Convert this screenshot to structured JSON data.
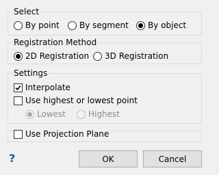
{
  "select": {
    "title": "Select",
    "options": [
      "By point",
      "By segment",
      "By object"
    ],
    "selected": "By object"
  },
  "registration": {
    "title": "Registration Method",
    "options": [
      "2D Registration",
      "3D Registration"
    ],
    "selected": "2D Registration"
  },
  "settings": {
    "title": "Settings",
    "interpolate_label": "Interpolate",
    "interpolate_checked": true,
    "use_highest_lowest_label": "Use highest or lowest point",
    "use_highest_lowest_checked": false,
    "point_options": [
      "Lowest",
      "Highest"
    ],
    "point_selected": "Lowest"
  },
  "projection": {
    "label": "Use Projection Plane",
    "checked": false
  },
  "footer": {
    "help_label": "?",
    "ok_label": "OK",
    "cancel_label": "Cancel"
  }
}
